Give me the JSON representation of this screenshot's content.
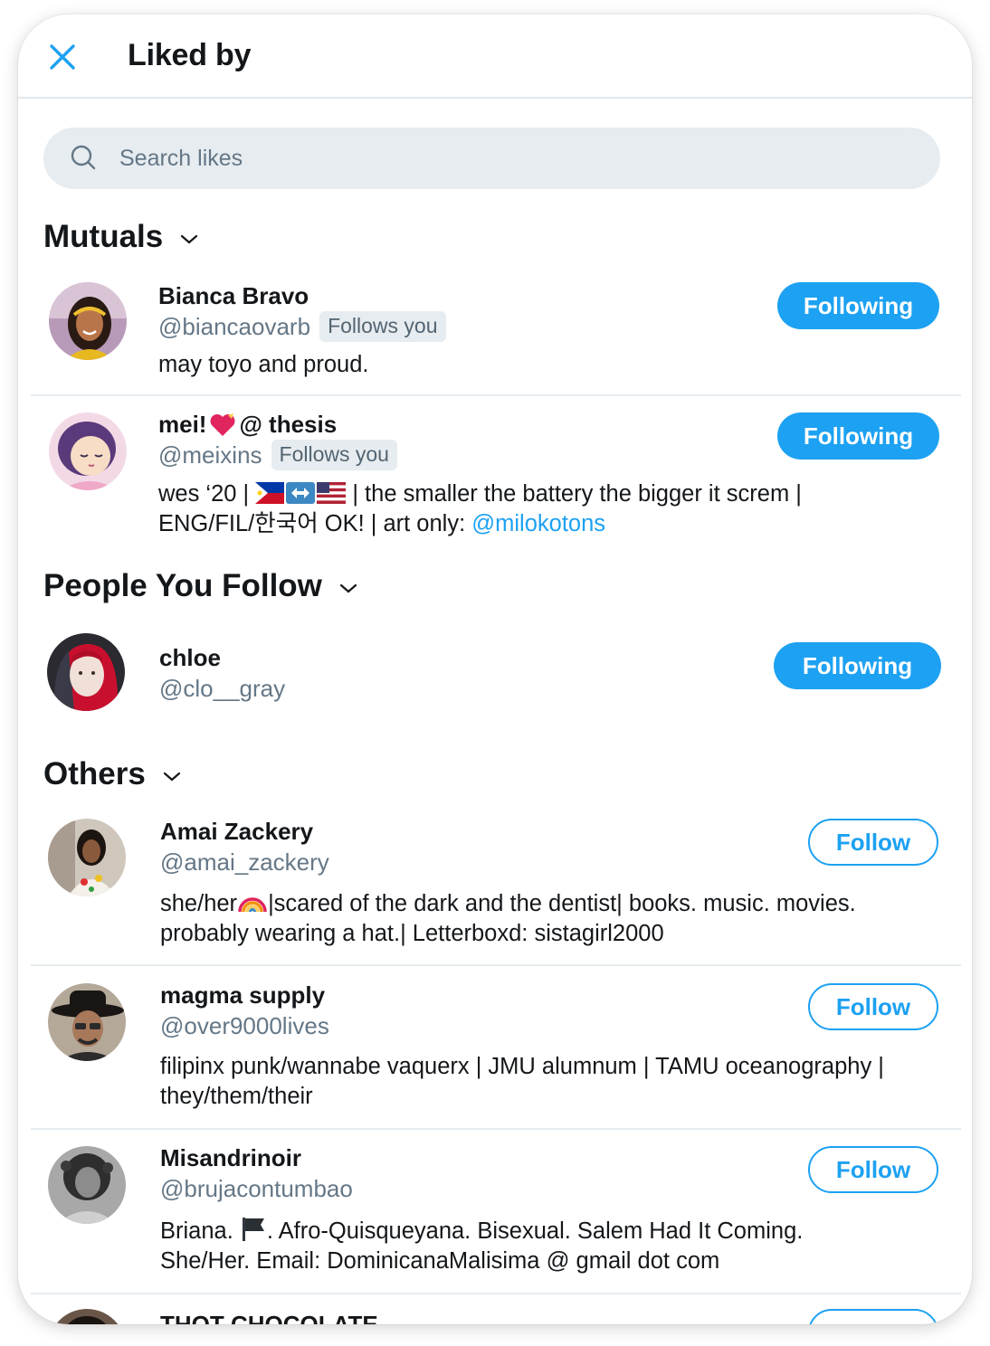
{
  "header": {
    "title": "Liked by",
    "close_icon": "close-icon"
  },
  "search": {
    "placeholder": "Search likes",
    "value": ""
  },
  "colors": {
    "accent": "#1da1f2",
    "muted": "#657786",
    "search_bg": "#e6ecf0"
  },
  "sections": {
    "mutuals": {
      "title": "Mutuals"
    },
    "people_you_follow": {
      "title": "People You Follow"
    },
    "others": {
      "title": "Others"
    }
  },
  "users": [
    {
      "name": "Bianca Bravo",
      "handle": "@biancaovarb",
      "follows_you": "Follows you",
      "bio": "may toyo and proud.",
      "button": "Following"
    },
    {
      "name": "mei! ",
      "name_suffix": " @ thesis",
      "handle": "@meixins",
      "follows_you": "Follows you",
      "bio_part1": "wes ‘20 | ",
      "bio_part2": " | the smaller the battery the bigger it screm |",
      "bio_line2": "ENG/FIL/한국어 OK! | art only: ",
      "bio_mention": "@milokotons",
      "button": "Following"
    },
    {
      "name": "chloe",
      "handle": "@clo__gray",
      "button": "Following"
    },
    {
      "name": "Amai Zackery",
      "handle": "@amai_zackery",
      "bio_part1": "she/her",
      "bio_part2": "|scared of the dark and the dentist| books. music. movies.",
      "bio_line2": "probably wearing a hat.| Letterboxd: sistagirl2000",
      "button": "Follow"
    },
    {
      "name": "magma supply",
      "handle": "@over9000lives",
      "bio_line1": "filipinx punk/wannabe vaquerx | JMU alumnum | TAMU oceanography |",
      "bio_line2": "they/them/their",
      "button": "Follow"
    },
    {
      "name": "Misandrinoir",
      "handle": "@brujacontumbao",
      "bio_part1": "Briana. ",
      "bio_part2": ". Afro-Quisqueyana. Bisexual. Salem Had It Coming.",
      "bio_line2": "She/Her. Email: DominicanaMalisima @ gmail dot com",
      "button": "Follow"
    },
    {
      "name": "THOT CHOCOLATE"
    }
  ]
}
